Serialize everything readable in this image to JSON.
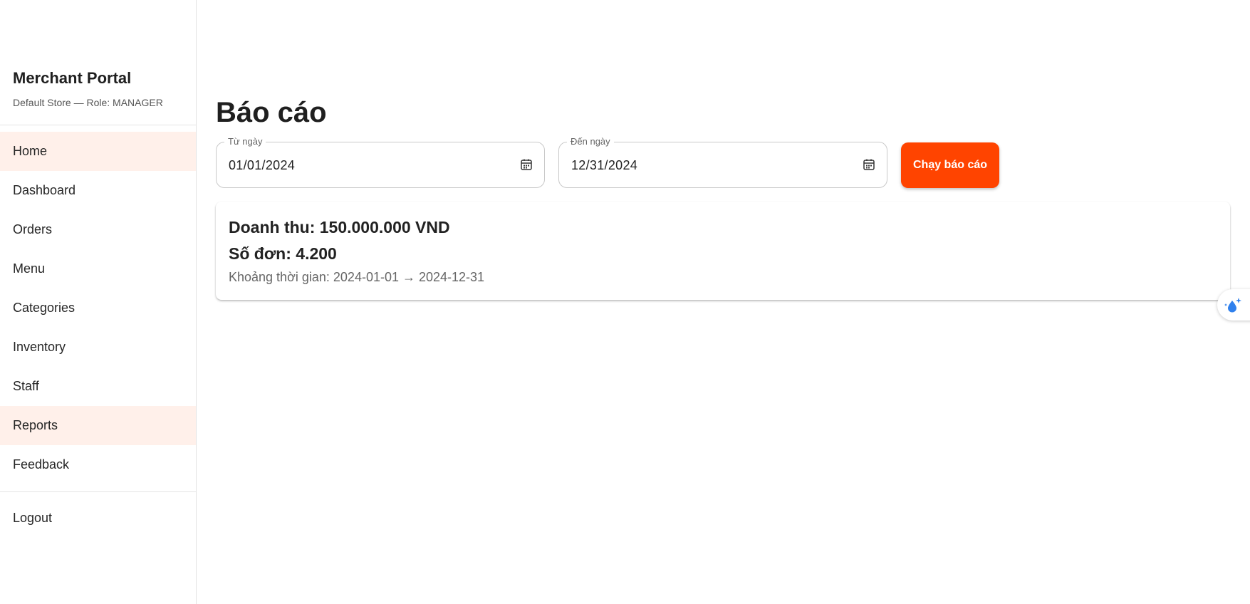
{
  "sidebar": {
    "brand": "Merchant Portal",
    "store_info": "Default Store — Role: MANAGER",
    "items": [
      {
        "label": "Home"
      },
      {
        "label": "Dashboard"
      },
      {
        "label": "Orders"
      },
      {
        "label": "Menu"
      },
      {
        "label": "Categories"
      },
      {
        "label": "Inventory"
      },
      {
        "label": "Staff"
      },
      {
        "label": "Reports"
      },
      {
        "label": "Feedback"
      }
    ],
    "logout": "Logout"
  },
  "main": {
    "title": "Báo cáo",
    "from_field": {
      "label": "Từ ngày",
      "value": "01/01/2024"
    },
    "to_field": {
      "label": "Đến ngày",
      "value": "12/31/2024"
    },
    "run_button": "Chạy báo cáo",
    "result": {
      "revenue": "Doanh thu: 150.000.000 VND",
      "orders": "Số đơn: 4.200",
      "range": "Khoảng thời gian: 2024-01-01 → 2024-12-31"
    }
  },
  "colors": {
    "accent": "#ff4400",
    "active_nav_bg": "#fff0ea",
    "float_icon": "#2f80ed"
  },
  "icons": {
    "date_picker": "calendar-icon",
    "floating": "water-drop-sparkle-icon"
  }
}
